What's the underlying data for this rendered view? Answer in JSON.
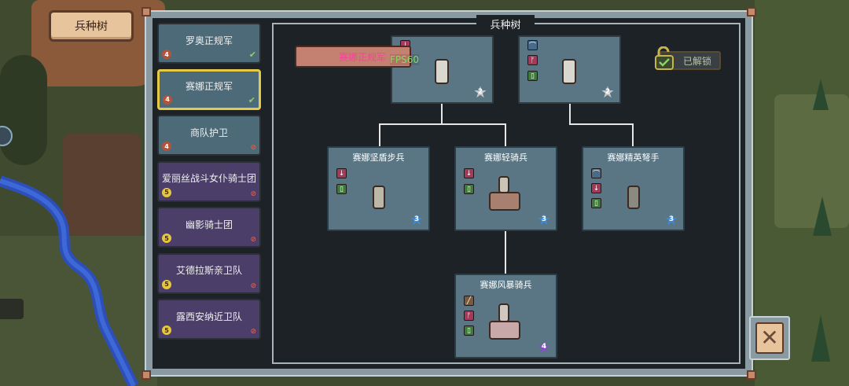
{
  "header": {
    "title_tab": "兵种树"
  },
  "tree": {
    "title": "兵种树"
  },
  "overlay": {
    "selected_chip": "赛娜正规军",
    "fps": "FPS60"
  },
  "unlock": {
    "label": "已解锁"
  },
  "sidebar": {
    "items": [
      {
        "label": "罗奥正规军",
        "tier": "4",
        "status": "unlocked"
      },
      {
        "label": "赛娜正规军",
        "tier": "4",
        "status": "unlocked",
        "selected": true
      },
      {
        "label": "商队护卫",
        "tier": "4",
        "status": "locked"
      },
      {
        "label": "爱丽丝战斗女仆骑士团",
        "tier": "5",
        "status": "locked"
      },
      {
        "label": "幽影骑士团",
        "tier": "5",
        "status": "locked"
      },
      {
        "label": "艾德拉斯亲卫队",
        "tier": "5",
        "status": "locked"
      },
      {
        "label": "露西安纳近卫队",
        "tier": "5",
        "status": "locked"
      }
    ]
  },
  "nodes": [
    {
      "name": "",
      "tier": "2",
      "icons": [
        "red-sword-icon"
      ]
    },
    {
      "name": "",
      "tier": "2",
      "icons": [
        "bow-icon",
        "axe-icon",
        "shield-icon"
      ]
    },
    {
      "name": "赛娜坚盾步兵",
      "tier": "3",
      "icons": [
        "sword-icon",
        "shield-icon"
      ]
    },
    {
      "name": "赛娜轻骑兵",
      "tier": "3",
      "icons": [
        "sword-icon",
        "shield-icon"
      ]
    },
    {
      "name": "赛娜精英弩手",
      "tier": "3",
      "icons": [
        "bow-icon",
        "sword-icon",
        "shield-icon"
      ]
    },
    {
      "name": "赛娜风暴骑兵",
      "tier": "4",
      "icons": [
        "lance-icon",
        "axe-icon",
        "shield-icon"
      ]
    }
  ],
  "colors": {
    "tier2": "#c8c8c8",
    "tier3": "#3a8adc",
    "tier4": "#8a4ad0",
    "accent": "#e7c94a"
  }
}
